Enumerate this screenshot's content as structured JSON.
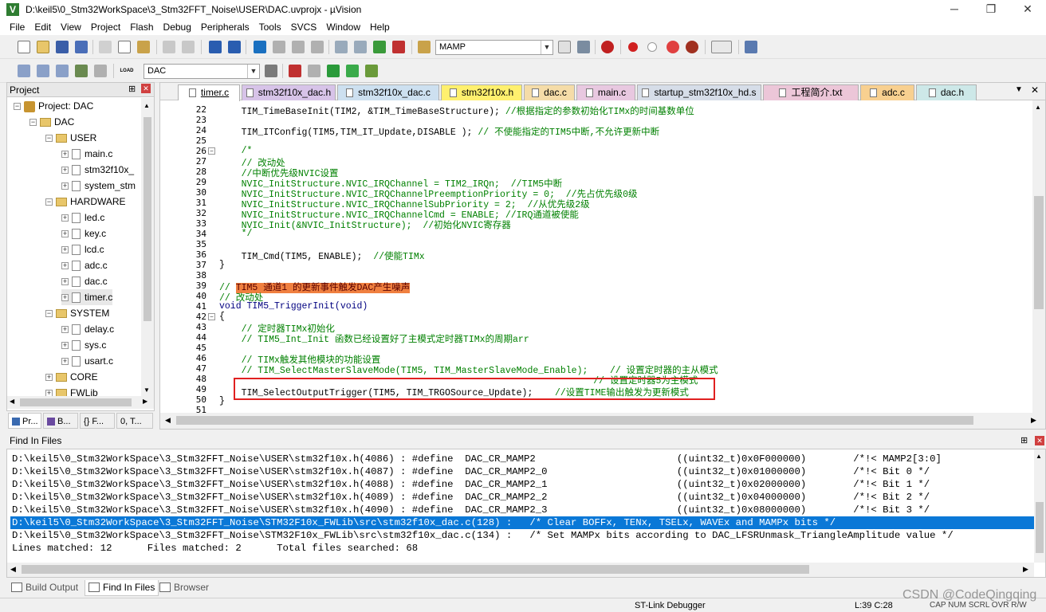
{
  "window": {
    "title": "D:\\keil5\\0_Stm32WorkSpace\\3_Stm32FFT_Noise\\USER\\DAC.uvprojx - µVision",
    "icon_letter": "V",
    "controls": {
      "minimize": "─",
      "maximize": "❐",
      "close": "✕"
    }
  },
  "menu": [
    "File",
    "Edit",
    "View",
    "Project",
    "Flash",
    "Debug",
    "Peripherals",
    "Tools",
    "SVCS",
    "Window",
    "Help"
  ],
  "toolbar": {
    "find_combo_value": "MAMP",
    "target_combo_value": "DAC",
    "load_label": "LOAD"
  },
  "project": {
    "header": "Project",
    "pin": "⊞",
    "close": "✕",
    "tree": [
      {
        "label": "Project: DAC",
        "kind": "project",
        "exp": "−",
        "level": 0
      },
      {
        "label": "DAC",
        "kind": "folder",
        "exp": "−",
        "level": 1
      },
      {
        "label": "USER",
        "kind": "folder",
        "exp": "−",
        "level": 2
      },
      {
        "label": "main.c",
        "kind": "file",
        "exp": "+",
        "level": 3
      },
      {
        "label": "stm32f10x_",
        "kind": "file",
        "exp": "+",
        "level": 3
      },
      {
        "label": "system_stm",
        "kind": "file",
        "exp": "+",
        "level": 3
      },
      {
        "label": "HARDWARE",
        "kind": "folder",
        "exp": "−",
        "level": 2
      },
      {
        "label": "led.c",
        "kind": "file",
        "exp": "+",
        "level": 3
      },
      {
        "label": "key.c",
        "kind": "file",
        "exp": "+",
        "level": 3
      },
      {
        "label": "lcd.c",
        "kind": "file",
        "exp": "+",
        "level": 3
      },
      {
        "label": "adc.c",
        "kind": "file",
        "exp": "+",
        "level": 3
      },
      {
        "label": "dac.c",
        "kind": "file",
        "exp": "+",
        "level": 3
      },
      {
        "label": "timer.c",
        "kind": "file",
        "exp": "+",
        "level": 3
      },
      {
        "label": "SYSTEM",
        "kind": "folder",
        "exp": "−",
        "level": 2
      },
      {
        "label": "delay.c",
        "kind": "file",
        "exp": "+",
        "level": 3
      },
      {
        "label": "sys.c",
        "kind": "file",
        "exp": "+",
        "level": 3
      },
      {
        "label": "usart.c",
        "kind": "file",
        "exp": "+",
        "level": 3
      },
      {
        "label": "CORE",
        "kind": "folder",
        "exp": "+",
        "level": 2
      },
      {
        "label": "FWLib",
        "kind": "folder",
        "exp": "+",
        "level": 2
      }
    ],
    "tabs": [
      "Pr...",
      "B...",
      "{} F...",
      "0, T..."
    ]
  },
  "editor": {
    "tabs": [
      {
        "label": "timer.c",
        "color": "#ffffff",
        "active": true
      },
      {
        "label": "stm32f10x_dac.h",
        "color": "#d7c3e8"
      },
      {
        "label": "stm32f10x_dac.c",
        "color": "#cde0f0"
      },
      {
        "label": "stm32f10x.h",
        "color": "#fff06e"
      },
      {
        "label": "dac.c",
        "color": "#f5dca8"
      },
      {
        "label": "main.c",
        "color": "#e8c8e0"
      },
      {
        "label": "startup_stm32f10x_hd.s",
        "color": "#d6dde8"
      },
      {
        "label": "工程简介.txt",
        "color": "#ecc6d8"
      },
      {
        "label": "adc.c",
        "color": "#f8d090"
      },
      {
        "label": "dac.h",
        "color": "#cde8e8"
      }
    ],
    "lines": [
      {
        "n": "22",
        "text": "    TIM_TimeBaseInit(TIM2, &TIM_TimeBaseStructure); ",
        "comment": "//根据指定的参数初始化TIMx的时间基数单位"
      },
      {
        "n": "23",
        "text": "",
        "comment": ""
      },
      {
        "n": "24",
        "text": "    TIM_ITConfig(TIM5,TIM_IT_Update,DISABLE ); ",
        "comment": "// 不使能指定的TIM5中断,不允许更新中断"
      },
      {
        "n": "25",
        "text": "",
        "comment": ""
      },
      {
        "n": "26",
        "text": "",
        "comment": "    /*",
        "fold": "−"
      },
      {
        "n": "27",
        "text": "",
        "comment": "    // 改动处"
      },
      {
        "n": "28",
        "text": "",
        "comment": "    //中断优先级NVIC设置"
      },
      {
        "n": "29",
        "text": "",
        "comment": "    NVIC_InitStructure.NVIC_IRQChannel = TIM2_IRQn;  //TIM5中断"
      },
      {
        "n": "30",
        "text": "",
        "comment": "    NVIC_InitStructure.NVIC_IRQChannelPreemptionPriority = 0;  //先占优先级0级"
      },
      {
        "n": "31",
        "text": "",
        "comment": "    NVIC_InitStructure.NVIC_IRQChannelSubPriority = 2;  //从优先级2级"
      },
      {
        "n": "32",
        "text": "",
        "comment": "    NVIC_InitStructure.NVIC_IRQChannelCmd = ENABLE; //IRQ通道被使能"
      },
      {
        "n": "33",
        "text": "",
        "comment": "    NVIC_Init(&NVIC_InitStructure);  //初始化NVIC寄存器"
      },
      {
        "n": "34",
        "text": "",
        "comment": "    */"
      },
      {
        "n": "35",
        "text": "",
        "comment": ""
      },
      {
        "n": "36",
        "text": "    TIM_Cmd(TIM5, ENABLE);  ",
        "comment": "//使能TIMx"
      },
      {
        "n": "37",
        "text": "}",
        "comment": ""
      },
      {
        "n": "38",
        "text": "",
        "comment": ""
      },
      {
        "n": "39",
        "text": "",
        "comment": "// ",
        "highlight": "TIM5 通道1 的更新事件触发DAC产生噪声"
      },
      {
        "n": "40",
        "text": "",
        "comment": "// 改动处"
      },
      {
        "n": "41",
        "text": "void TIM5_TriggerInit(void)",
        "comment": ""
      },
      {
        "n": "42",
        "text": "{",
        "comment": "",
        "fold": "−"
      },
      {
        "n": "43",
        "text": "",
        "comment": "    // 定时器TIMx初始化"
      },
      {
        "n": "44",
        "text": "",
        "comment": "    // TIM5_Int_Init 函数已经设置好了主模式定时器TIMx的周期arr"
      },
      {
        "n": "45",
        "text": "",
        "comment": ""
      },
      {
        "n": "46",
        "text": "",
        "comment": "    // TIMx触发其他模块的功能设置"
      },
      {
        "n": "47",
        "text": "",
        "comment": "    // TIM_SelectMasterSlaveMode(TIM5, TIM_MasterSlaveMode_Enable);    // 设置定时器的主从模式"
      },
      {
        "n": "48",
        "text": "",
        "comment": "                                                                    // 设置定时器5为主模式"
      },
      {
        "n": "49",
        "text": "    TIM_SelectOutputTrigger(TIM5, TIM_TRGOSource_Update);    ",
        "comment": "//设置TIME输出触发为更新模式"
      },
      {
        "n": "50",
        "text": "}",
        "comment": ""
      },
      {
        "n": "51",
        "text": "",
        "comment": ""
      }
    ]
  },
  "find": {
    "title": "Find In Files",
    "rows": [
      "D:\\keil5\\0_Stm32WorkSpace\\3_Stm32FFT_Noise\\USER\\stm32f10x.h(4086) : #define  DAC_CR_MAMP2                        ((uint32_t)0x0F000000)        /*!< MAMP2[3:0]",
      "D:\\keil5\\0_Stm32WorkSpace\\3_Stm32FFT_Noise\\USER\\stm32f10x.h(4087) : #define  DAC_CR_MAMP2_0                      ((uint32_t)0x01000000)        /*!< Bit 0 */",
      "D:\\keil5\\0_Stm32WorkSpace\\3_Stm32FFT_Noise\\USER\\stm32f10x.h(4088) : #define  DAC_CR_MAMP2_1                      ((uint32_t)0x02000000)        /*!< Bit 1 */",
      "D:\\keil5\\0_Stm32WorkSpace\\3_Stm32FFT_Noise\\USER\\stm32f10x.h(4089) : #define  DAC_CR_MAMP2_2                      ((uint32_t)0x04000000)        /*!< Bit 2 */",
      "D:\\keil5\\0_Stm32WorkSpace\\3_Stm32FFT_Noise\\USER\\stm32f10x.h(4090) : #define  DAC_CR_MAMP2_3                      ((uint32_t)0x08000000)        /*!< Bit 3 */",
      "D:\\keil5\\0_Stm32WorkSpace\\3_Stm32FFT_Noise\\STM32F10x_FWLib\\src\\stm32f10x_dac.c(128) :   /* Clear BOFFx, TENx, TSELx, WAVEx and MAMPx bits */",
      "D:\\keil5\\0_Stm32WorkSpace\\3_Stm32FFT_Noise\\STM32F10x_FWLib\\src\\stm32f10x_dac.c(134) :   /* Set MAMPx bits according to DAC_LFSRUnmask_TriangleAmplitude value */",
      "Lines matched: 12      Files matched: 2      Total files searched: 68"
    ],
    "selected_index": 5
  },
  "bottom_tabs": [
    "Build Output",
    "Find In Files",
    "Browser"
  ],
  "status": {
    "debugger": "ST-Link Debugger",
    "position": "L:39 C:28",
    "indicators": "CAP  NUM  SCRL  OVR  R/W",
    "watermark": "CSDN @CodeQingqing"
  },
  "colors": {
    "selection": "#0a78d7",
    "highlight": "#f08040",
    "comment": "#008000",
    "redbox": "#e02020"
  }
}
